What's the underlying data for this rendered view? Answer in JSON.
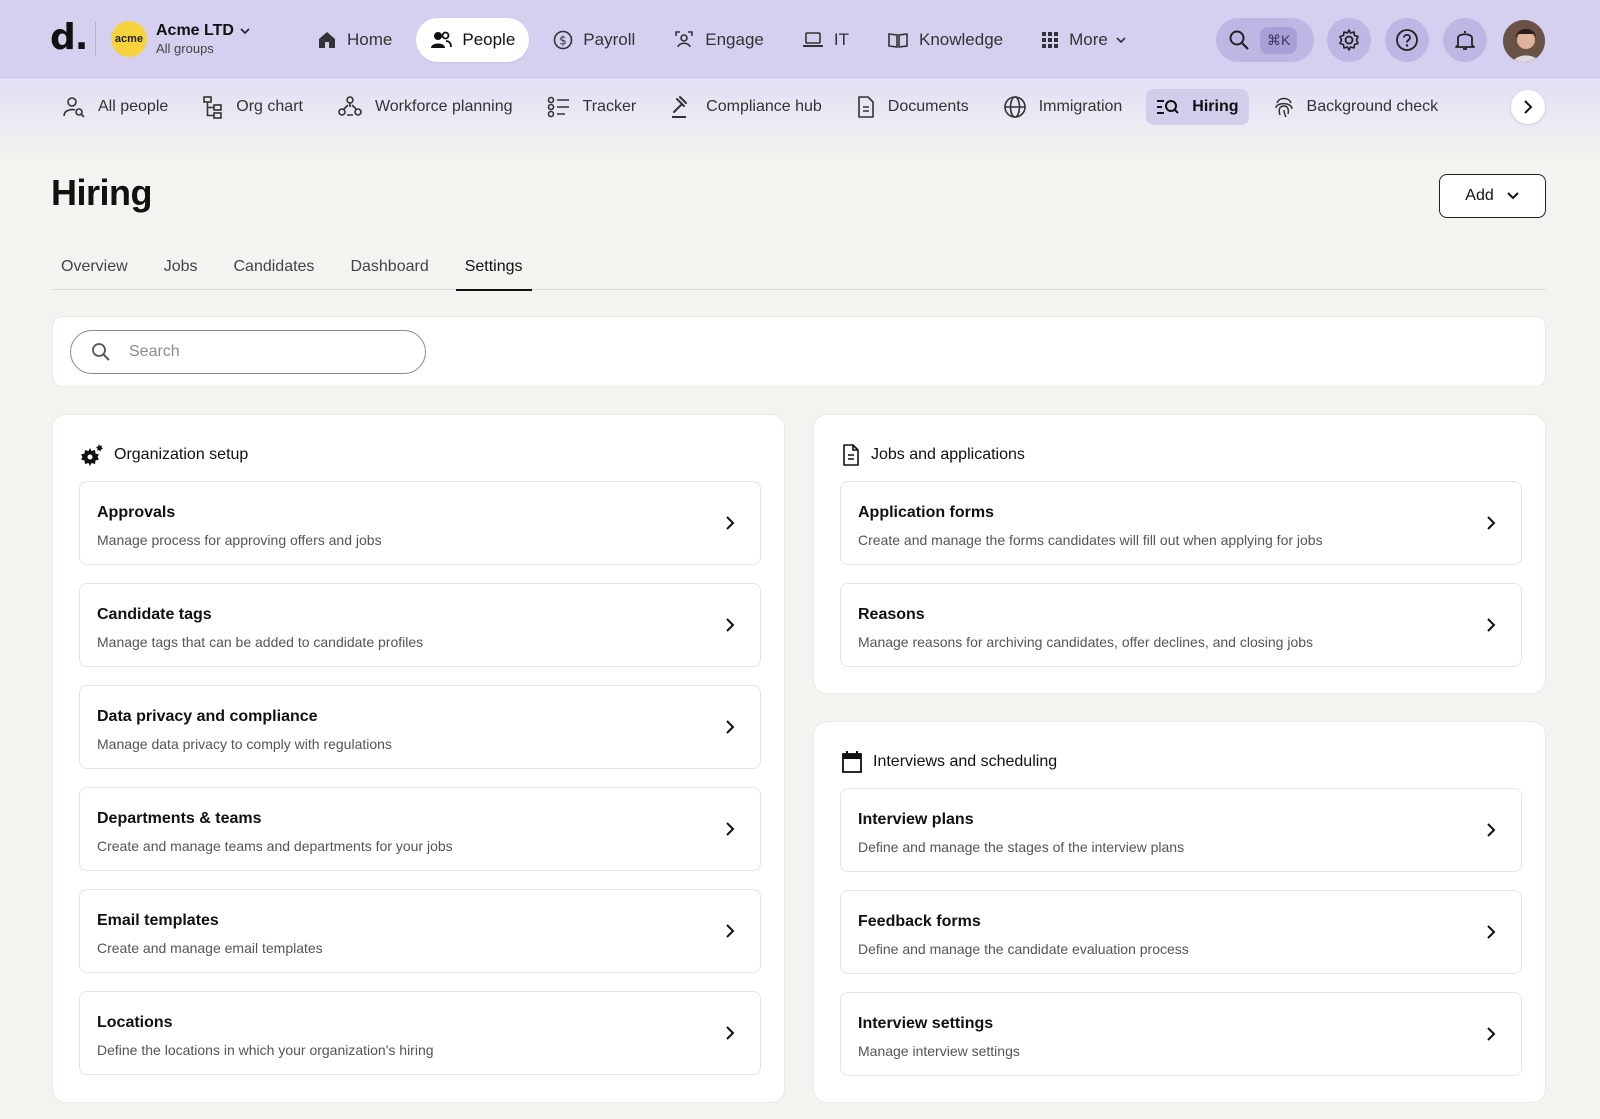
{
  "app": {
    "logo": "d.",
    "org": {
      "avatar": "acme",
      "name": "Acme LTD",
      "sub": "All groups"
    },
    "nav": [
      {
        "label": "Home"
      },
      {
        "label": "People"
      },
      {
        "label": "Payroll"
      },
      {
        "label": "Engage"
      },
      {
        "label": "IT"
      },
      {
        "label": "Knowledge"
      },
      {
        "label": "More"
      }
    ],
    "search_shortcut": "⌘K",
    "colors": {
      "topbar": "#d5cff0",
      "accent": "#bfb6e4",
      "page_bg": "#f4f3f0"
    }
  },
  "subnav": [
    {
      "label": "All people"
    },
    {
      "label": "Org chart"
    },
    {
      "label": "Workforce planning"
    },
    {
      "label": "Tracker"
    },
    {
      "label": "Compliance hub"
    },
    {
      "label": "Documents"
    },
    {
      "label": "Immigration"
    },
    {
      "label": "Hiring"
    },
    {
      "label": "Background check"
    }
  ],
  "page": {
    "title": "Hiring",
    "add_label": "Add",
    "tabs": [
      {
        "label": "Overview"
      },
      {
        "label": "Jobs"
      },
      {
        "label": "Candidates"
      },
      {
        "label": "Dashboard"
      },
      {
        "label": "Settings"
      }
    ],
    "search_placeholder": "Search"
  },
  "sections": {
    "org_setup": {
      "title": "Organization setup",
      "items": [
        {
          "title": "Approvals",
          "desc": "Manage process for approving offers and jobs"
        },
        {
          "title": "Candidate tags",
          "desc": "Manage tags that can be added to candidate profiles"
        },
        {
          "title": "Data privacy and compliance",
          "desc": "Manage data privacy to comply with regulations"
        },
        {
          "title": "Departments & teams",
          "desc": "Create and manage teams and departments for your jobs"
        },
        {
          "title": "Email templates",
          "desc": "Create and manage email templates"
        },
        {
          "title": "Locations",
          "desc": "Define the locations in which your organization's hiring"
        }
      ]
    },
    "jobs_apps": {
      "title": "Jobs and applications",
      "items": [
        {
          "title": "Application forms",
          "desc": "Create and manage the forms candidates will fill out when applying for jobs"
        },
        {
          "title": "Reasons",
          "desc": "Manage reasons for archiving candidates, offer declines, and closing jobs"
        }
      ]
    },
    "interviews": {
      "title": "Interviews and scheduling",
      "items": [
        {
          "title": "Interview plans",
          "desc": "Define and manage the stages of the interview plans"
        },
        {
          "title": "Feedback forms",
          "desc": "Define and manage the candidate evaluation process"
        },
        {
          "title": "Interview settings",
          "desc": "Manage interview settings"
        }
      ]
    }
  }
}
